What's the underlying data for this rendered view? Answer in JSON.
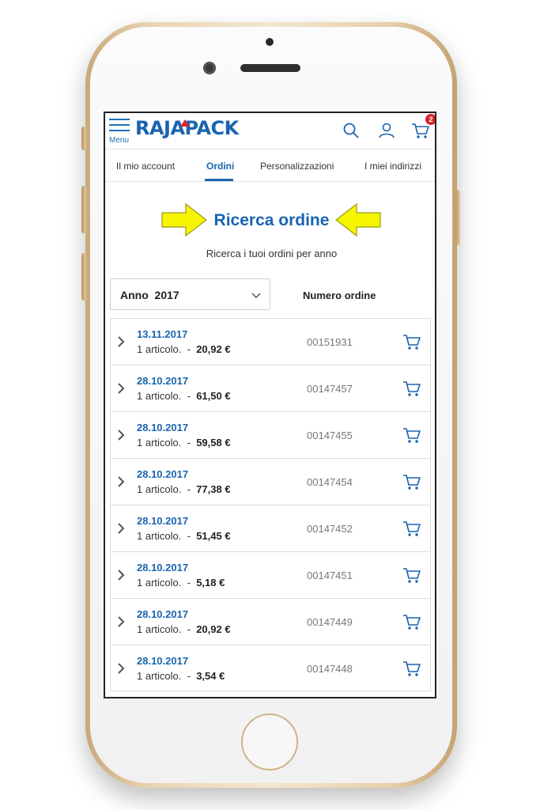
{
  "header": {
    "menu_label": "Menu",
    "logo_text": "RAJAPACK",
    "cart_count": "2",
    "colors": {
      "brand": "#1a64b0",
      "accent_red": "#d9262b"
    },
    "icons": [
      "menu-icon",
      "search-icon",
      "user-icon",
      "cart-icon"
    ]
  },
  "tabs": [
    {
      "label": "Il mio account",
      "active": false
    },
    {
      "label": "Ordini",
      "active": true
    },
    {
      "label": "Personalizzazioni",
      "active": false
    },
    {
      "label": "I miei indirizzi",
      "active": false
    }
  ],
  "page": {
    "title": "Ricerca ordine",
    "subtitle": "Ricerca i tuoi ordini per anno",
    "highlight_color": "#f5f500"
  },
  "filters": {
    "year_prefix": "Anno",
    "year_value": "2017",
    "number_column_label": "Numero ordine"
  },
  "orders": [
    {
      "date": "13.11.2017",
      "items": "1 articolo.",
      "separator": "-",
      "total": "20,92 €",
      "number": "00151931"
    },
    {
      "date": "28.10.2017",
      "items": "1 articolo.",
      "separator": "-",
      "total": "61,50 €",
      "number": "00147457"
    },
    {
      "date": "28.10.2017",
      "items": "1 articolo.",
      "separator": "-",
      "total": "59,58 €",
      "number": "00147455"
    },
    {
      "date": "28.10.2017",
      "items": "1 articolo.",
      "separator": "-",
      "total": "77,38 €",
      "number": "00147454"
    },
    {
      "date": "28.10.2017",
      "items": "1 articolo.",
      "separator": "-",
      "total": "51,45 €",
      "number": "00147452"
    },
    {
      "date": "28.10.2017",
      "items": "1 articolo.",
      "separator": "-",
      "total": "5,18 €",
      "number": "00147451"
    },
    {
      "date": "28.10.2017",
      "items": "1 articolo.",
      "separator": "-",
      "total": "20,92 €",
      "number": "00147449"
    },
    {
      "date": "28.10.2017",
      "items": "1 articolo.",
      "separator": "-",
      "total": "3,54 €",
      "number": "00147448"
    }
  ]
}
